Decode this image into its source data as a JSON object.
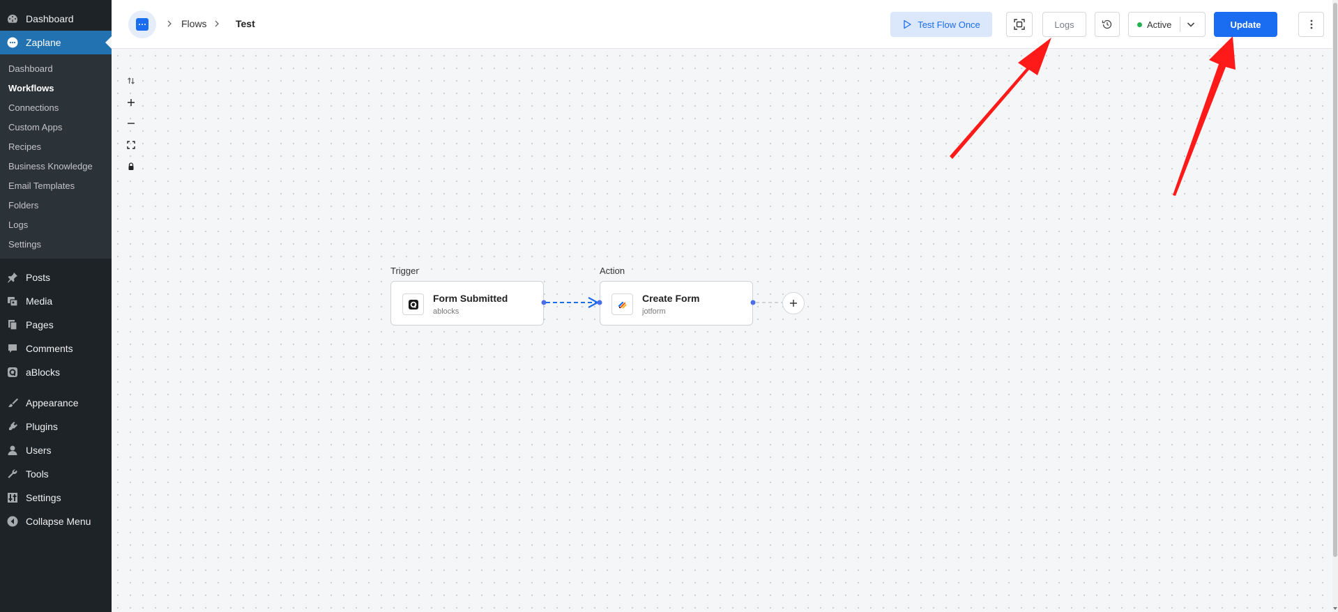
{
  "sidebar": {
    "top": [
      {
        "label": "Dashboard",
        "icon": "dashboard-icon"
      },
      {
        "label": "Zaplane",
        "icon": "zaplane-icon"
      }
    ],
    "submenu": [
      "Dashboard",
      "Workflows",
      "Connections",
      "Custom Apps",
      "Recipes",
      "Business Knowledge",
      "Email Templates",
      "Folders",
      "Logs",
      "Settings"
    ],
    "bottom": [
      {
        "label": "Posts",
        "icon": "pin-icon"
      },
      {
        "label": "Media",
        "icon": "media-icon"
      },
      {
        "label": "Pages",
        "icon": "pages-icon"
      },
      {
        "label": "Comments",
        "icon": "comment-icon"
      },
      {
        "label": "aBlocks",
        "icon": "ablocks-icon"
      },
      {
        "label": "Appearance",
        "icon": "brush-icon"
      },
      {
        "label": "Plugins",
        "icon": "plug-icon"
      },
      {
        "label": "Users",
        "icon": "user-icon"
      },
      {
        "label": "Tools",
        "icon": "wrench-icon"
      },
      {
        "label": "Settings",
        "icon": "settings-icon"
      },
      {
        "label": "Collapse Menu",
        "icon": "collapse-icon"
      }
    ]
  },
  "header": {
    "breadcrumb": [
      "Flows",
      "Test"
    ],
    "test_label": "Test Flow Once",
    "logs_label": "Logs",
    "status_label": "Active",
    "update_label": "Update"
  },
  "flow": {
    "trigger_label": "Trigger",
    "action_label": "Action",
    "trigger": {
      "title": "Form Submitted",
      "app": "ablocks"
    },
    "action": {
      "title": "Create Form",
      "app": "jotform"
    }
  },
  "colors": {
    "sidebar_bg": "#1d2327",
    "wp_blue": "#2271b1",
    "accent": "#1a6cf0",
    "status_green": "#22b14c",
    "annotation_red": "#ff1a1a"
  }
}
